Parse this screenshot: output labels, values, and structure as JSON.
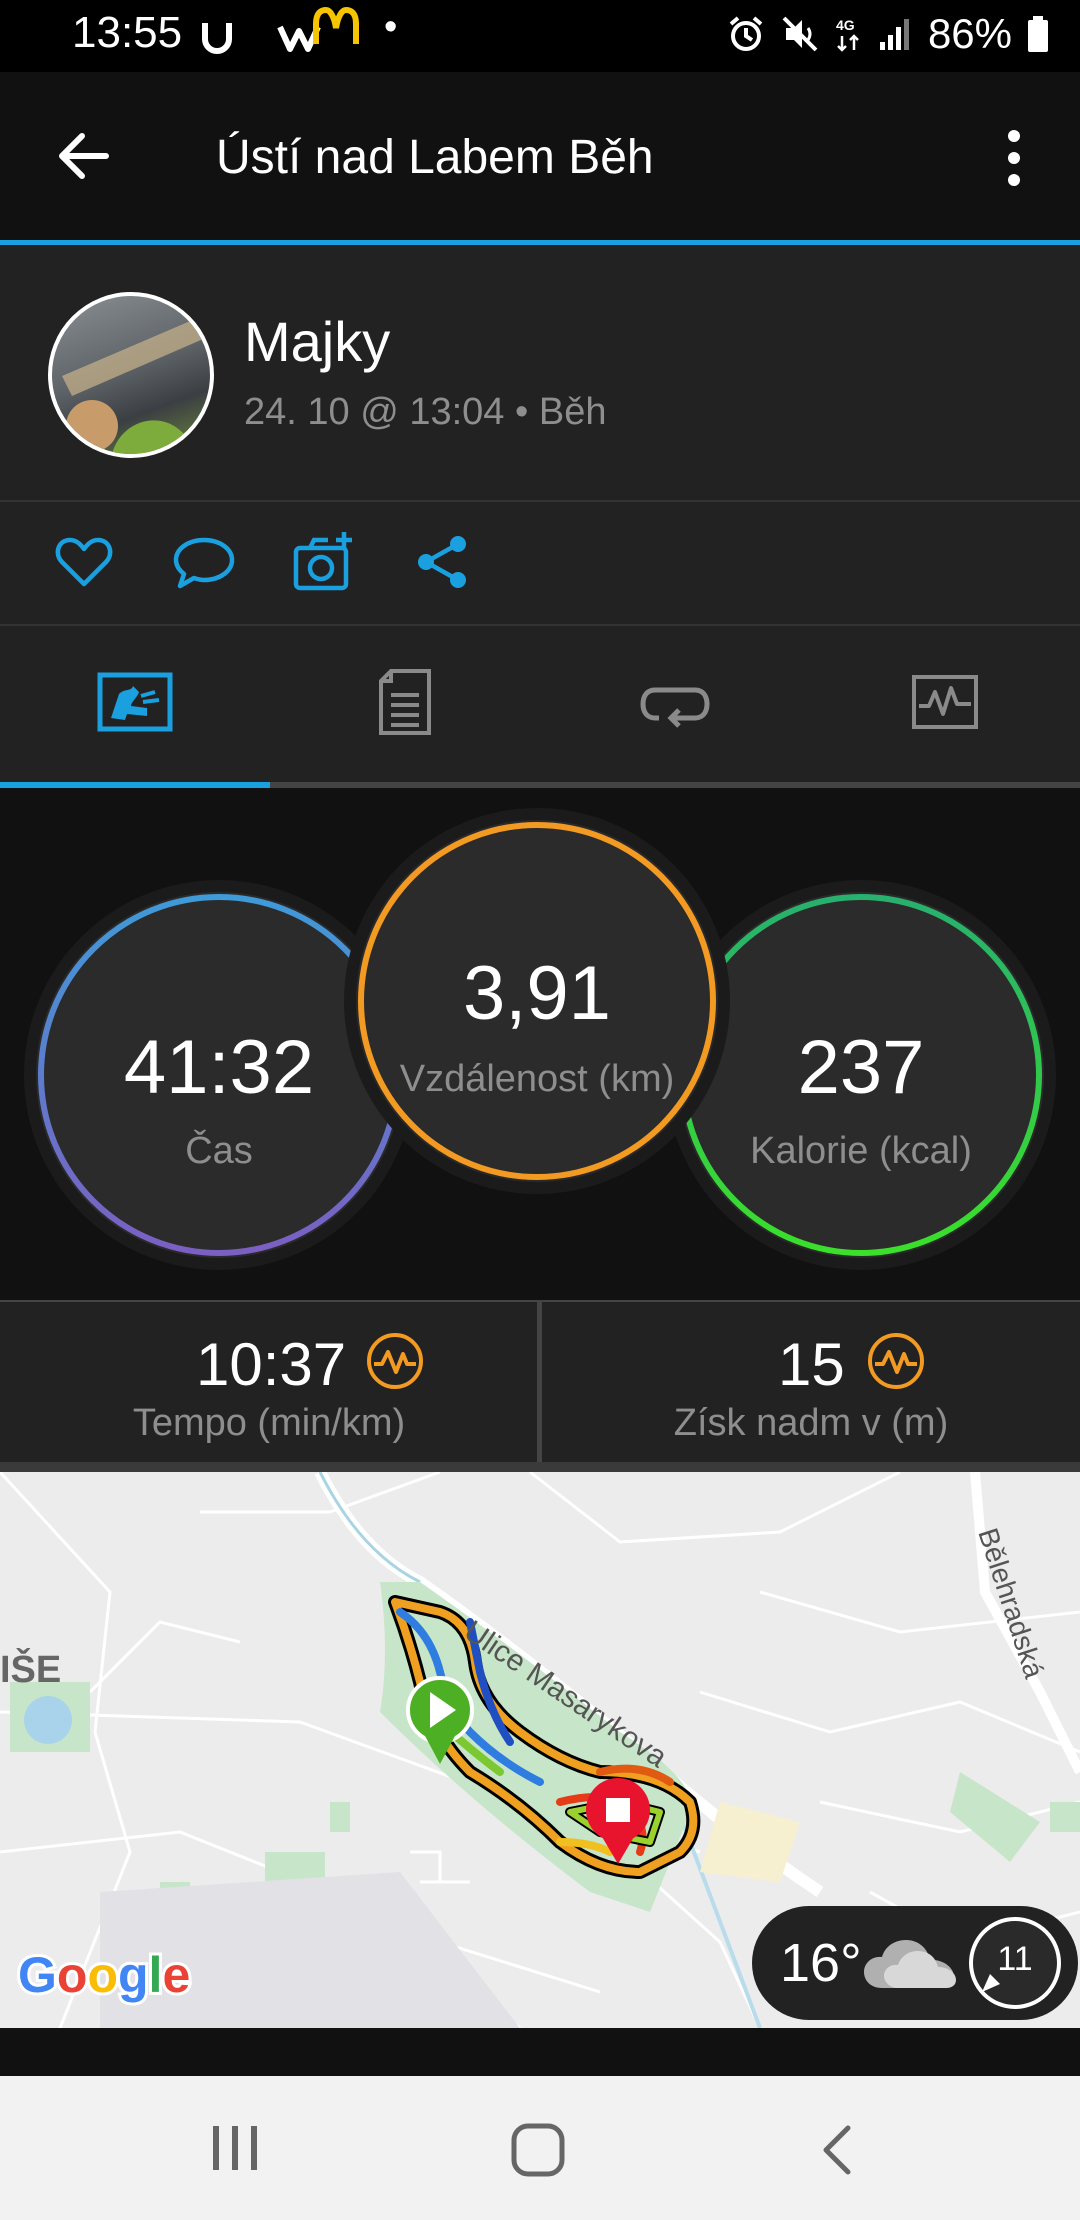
{
  "status_bar": {
    "time": "13:55",
    "left_icons": [
      "notification-u-icon",
      "notification-w-icon",
      "mcdonalds-icon",
      "dot-icon"
    ],
    "battery": "86%",
    "right_icons": [
      "alarm-icon",
      "mute-icon",
      "4g-icon",
      "signal-icon",
      "battery-icon"
    ],
    "network": "4G"
  },
  "app_bar": {
    "title": "Ústí nad Labem Běh"
  },
  "profile": {
    "name": "Majky",
    "subtitle": "24. 10 @ 13:04 • Běh"
  },
  "actions": [
    "like-icon",
    "comment-icon",
    "add-photo-icon",
    "share-icon"
  ],
  "tabs": {
    "items": [
      "overview-tab-icon",
      "details-tab-icon",
      "laps-tab-icon",
      "charts-tab-icon"
    ],
    "active_index": 0
  },
  "stats": {
    "time": {
      "value": "41:32",
      "label": "Čas"
    },
    "distance": {
      "value": "3,91",
      "label": "Vzdálenost (km)"
    },
    "calories": {
      "value": "237",
      "label": "Kalorie (kcal)"
    }
  },
  "metrics": {
    "pace": {
      "value": "10:37",
      "label": "Tempo (min/km)"
    },
    "elevation": {
      "value": "15",
      "label": "Získ nadm v (m)"
    }
  },
  "map": {
    "street_1": "Ulice Masarykova",
    "street_2": "Bělehradská",
    "district_fragment": "IŠE",
    "provider": "Google"
  },
  "weather": {
    "temperature": "16°",
    "wind": "11",
    "icon": "cloud-icon"
  },
  "colors": {
    "accent": "#1a9fdf",
    "time_ring": "#5b8fdc",
    "distance_ring": "#f39a23",
    "calories_ring": "#2ecc40",
    "pulse_icon": "#f39a23",
    "start_marker": "#4caf24",
    "end_marker": "#e8132c"
  },
  "navbar": [
    "recent-apps-icon",
    "home-icon",
    "back-nav-icon"
  ]
}
